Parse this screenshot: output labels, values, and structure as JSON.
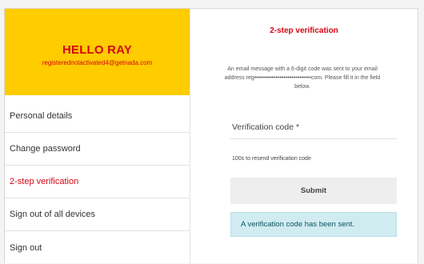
{
  "user": {
    "greeting": "HELLO RAY",
    "email": "registerednotactivated4@getnada.com"
  },
  "sidebar": {
    "items": [
      {
        "label": "Personal details",
        "active": false
      },
      {
        "label": "Change password",
        "active": false
      },
      {
        "label": "2-step verification",
        "active": true
      },
      {
        "label": "Sign out of all devices",
        "active": false
      },
      {
        "label": "Sign out",
        "active": false
      }
    ]
  },
  "verification": {
    "title": "2-step verification",
    "description": "An email message with a 6-digit code was sent to your email address reg•••••••••••••••••••••••••••••com. Please fill it in the field below.",
    "field_label": "Verification code *",
    "field_value": "",
    "resend_text": "100s to resend verification code",
    "submit_label": "Submit",
    "alert_text": "A verification code has been sent."
  },
  "colors": {
    "brand_yellow": "#ffcc00",
    "brand_red": "#d40511",
    "alert_bg": "#d1ecf1"
  }
}
